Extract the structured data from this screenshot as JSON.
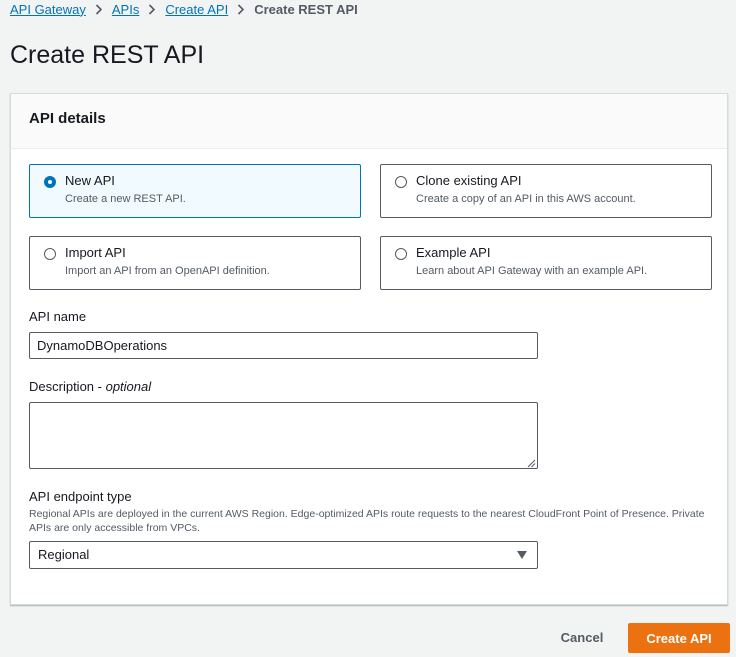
{
  "breadcrumb": {
    "items": [
      "API Gateway",
      "APIs",
      "Create API"
    ],
    "current": "Create REST API"
  },
  "page": {
    "title": "Create REST API"
  },
  "panel": {
    "title": "API details",
    "options": [
      {
        "title": "New API",
        "description": "Create a new REST API.",
        "selected": true
      },
      {
        "title": "Clone existing API",
        "description": "Create a copy of an API in this AWS account.",
        "selected": false
      },
      {
        "title": "Import API",
        "description": "Import an API from an OpenAPI definition.",
        "selected": false
      },
      {
        "title": "Example API",
        "description": "Learn about API Gateway with an example API.",
        "selected": false
      }
    ]
  },
  "form": {
    "api_name": {
      "label": "API name",
      "value": "DynamoDBOperations"
    },
    "description": {
      "label": "Description",
      "label_suffix": "optional",
      "value": ""
    },
    "endpoint_type": {
      "label": "API endpoint type",
      "help": "Regional APIs are deployed in the current AWS Region. Edge-optimized APIs route requests to the nearest CloudFront Point of Presence. Private APIs are only accessible from VPCs.",
      "selected": "Regional"
    }
  },
  "actions": {
    "cancel_label": "Cancel",
    "create_label": "Create API"
  },
  "colors": {
    "link": "#0073bb",
    "primary_button": "#ec7211",
    "selected_border": "#0073bb",
    "selected_bg": "#f1faff"
  }
}
